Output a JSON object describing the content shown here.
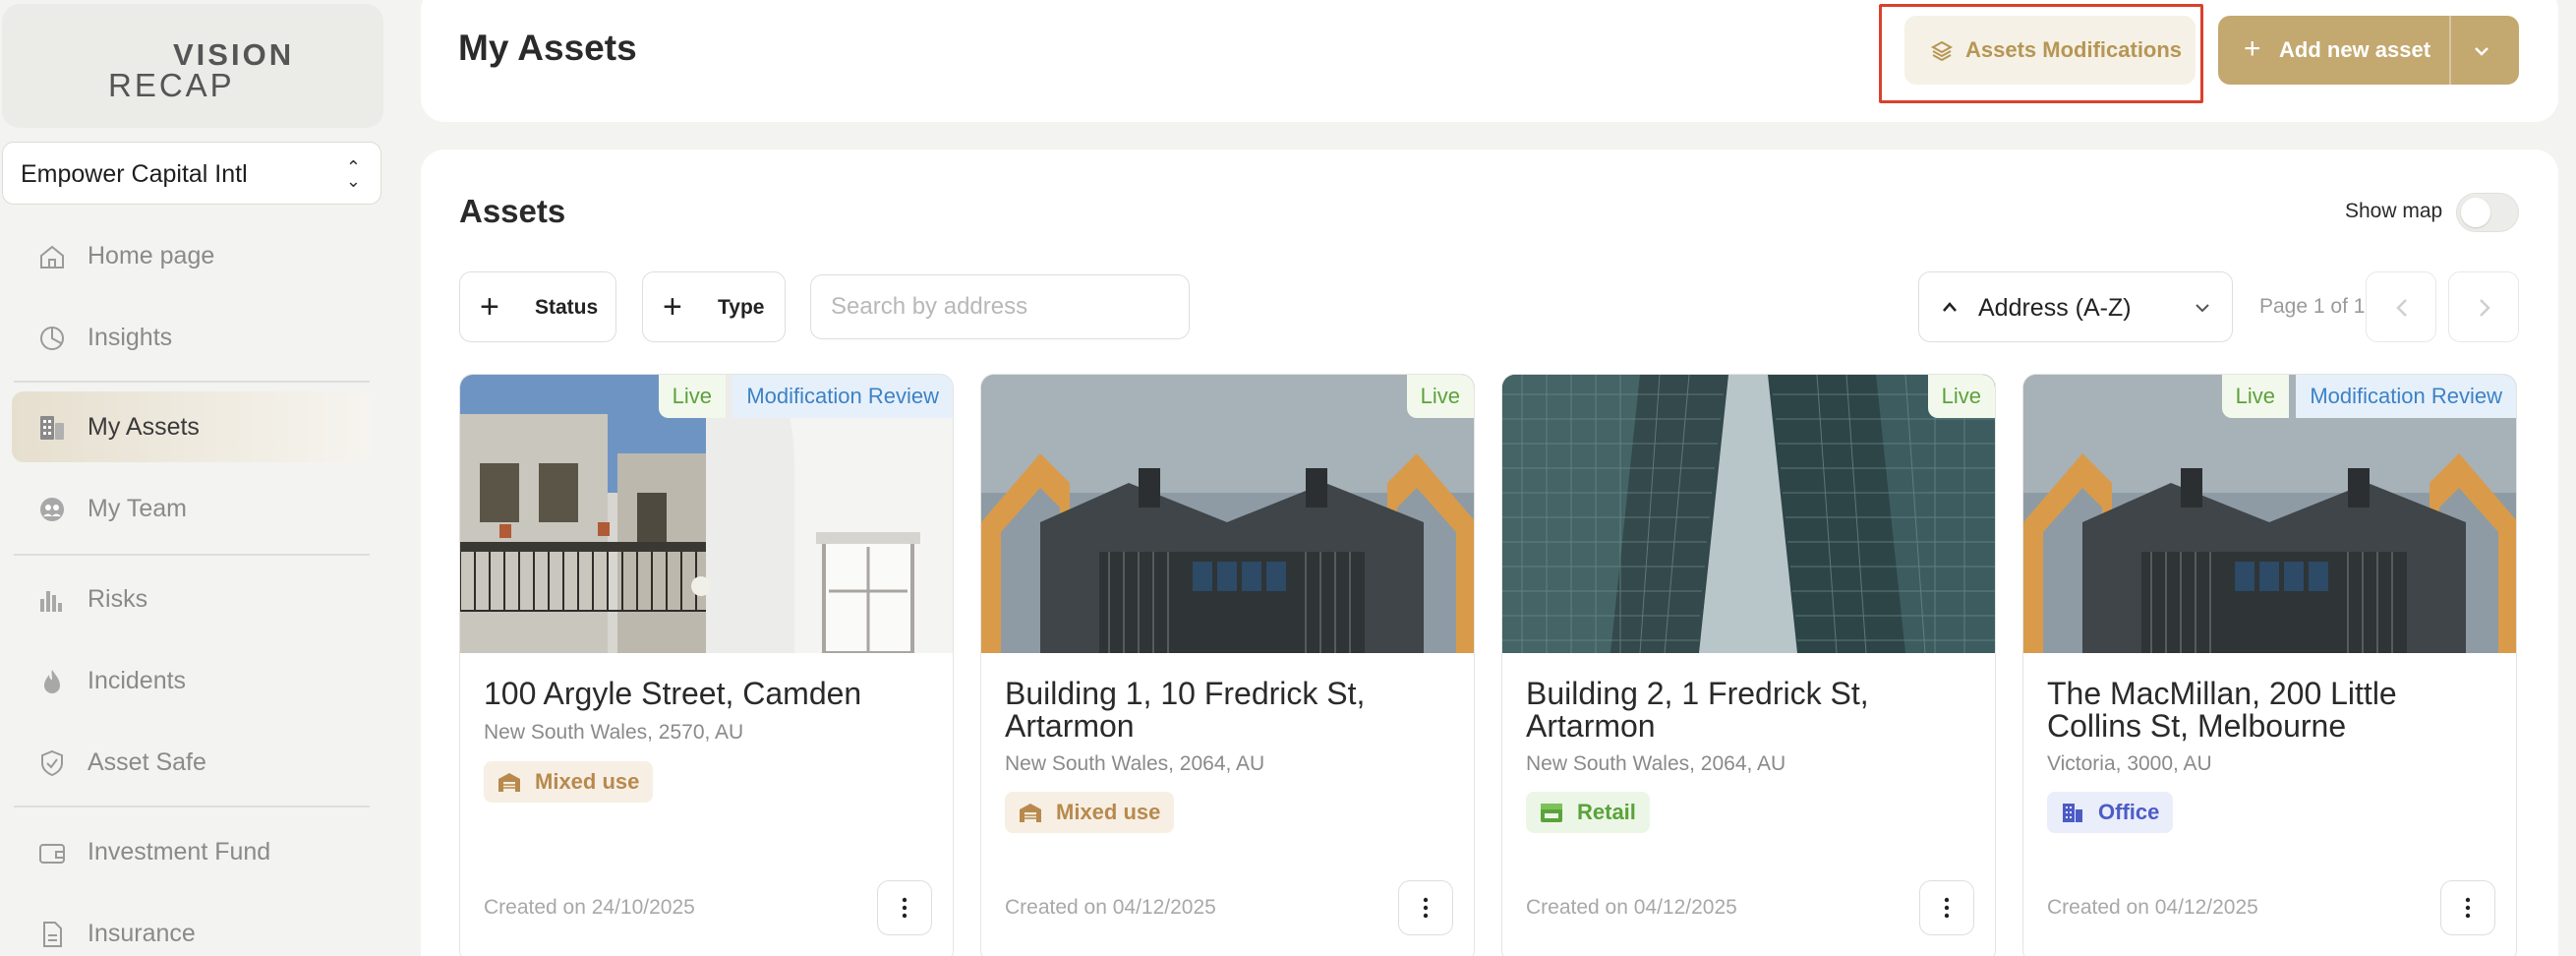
{
  "brand": {
    "line1": "VISION",
    "line2": "RECAP"
  },
  "org_selector": {
    "value": "Empower Capital Intl"
  },
  "nav": {
    "home": "Home page",
    "insights": "Insights",
    "assets": "My Assets",
    "team": "My Team",
    "risks": "Risks",
    "incidents": "Incidents",
    "asset_safe": "Asset Safe",
    "investment_fund": "Investment Fund",
    "insurance": "Insurance"
  },
  "header": {
    "title": "My Assets",
    "modifications_button": "Assets Modifications",
    "add_button": "Add new asset"
  },
  "assets_section": {
    "title": "Assets",
    "show_map_label": "Show map",
    "show_map_on": false,
    "filters": {
      "status": "Status",
      "type": "Type"
    },
    "search_placeholder": "Search by address",
    "sort": "Address (A-Z)",
    "pagination": "Page 1 of 1"
  },
  "colors": {
    "accent": "#c3a870",
    "highlight_border": "#d9412c"
  },
  "cards": [
    {
      "live": "Live",
      "review": "Modification Review",
      "address": "100 Argyle Street, Camden",
      "location": "New South Wales, 2570, AU",
      "type": "Mixed use",
      "created": "Created on 24/10/2025"
    },
    {
      "live": "Live",
      "address": "Building 1, 10 Fredrick St, Artarmon",
      "location": "New South Wales, 2064, AU",
      "type": "Mixed use",
      "created": "Created on 04/12/2025"
    },
    {
      "live": "Live",
      "address": "Building 2, 1 Fredrick St, Artarmon",
      "location": "New South Wales, 2064, AU",
      "type": "Retail",
      "created": "Created on 04/12/2025"
    },
    {
      "live": "Live",
      "review": "Modification Review",
      "address": "The MacMillan, 200 Little Collins St, Melbourne",
      "location": "Victoria, 3000, AU",
      "type": "Office",
      "created": "Created on 04/12/2025"
    }
  ]
}
